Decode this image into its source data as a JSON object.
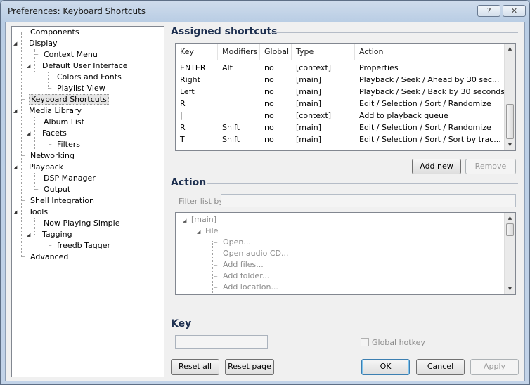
{
  "window": {
    "title": "Preferences: Keyboard Shortcuts",
    "help_label": "?",
    "close_label": "✕"
  },
  "tree": {
    "items": [
      {
        "label": "Components"
      },
      {
        "label": "Display"
      },
      {
        "label": "Context Menu"
      },
      {
        "label": "Default User Interface"
      },
      {
        "label": "Colors and Fonts"
      },
      {
        "label": "Playlist View"
      },
      {
        "label": "Keyboard Shortcuts"
      },
      {
        "label": "Media Library"
      },
      {
        "label": "Album List"
      },
      {
        "label": "Facets"
      },
      {
        "label": "Filters"
      },
      {
        "label": "Networking"
      },
      {
        "label": "Playback"
      },
      {
        "label": "DSP Manager"
      },
      {
        "label": "Output"
      },
      {
        "label": "Shell Integration"
      },
      {
        "label": "Tools"
      },
      {
        "label": "Now Playing Simple"
      },
      {
        "label": "Tagging"
      },
      {
        "label": "freedb Tagger"
      },
      {
        "label": "Advanced"
      }
    ]
  },
  "assigned": {
    "title": "Assigned shortcuts",
    "columns": [
      "Key",
      "Modifiers",
      "Global",
      "Type",
      "Action"
    ],
    "rows": [
      {
        "key": "ENTER",
        "modifiers": "Alt",
        "global": "no",
        "type": "[context]",
        "action": "Properties"
      },
      {
        "key": "Right",
        "modifiers": "",
        "global": "no",
        "type": "[main]",
        "action": "Playback / Seek / Ahead by 30 sec..."
      },
      {
        "key": "Left",
        "modifiers": "",
        "global": "no",
        "type": "[main]",
        "action": "Playback / Seek / Back by 30 seconds"
      },
      {
        "key": "R",
        "modifiers": "",
        "global": "no",
        "type": "[main]",
        "action": "Edit / Selection / Sort / Randomize"
      },
      {
        "key": "|",
        "modifiers": "",
        "global": "no",
        "type": "[context]",
        "action": "Add to playback queue"
      },
      {
        "key": "R",
        "modifiers": "Shift",
        "global": "no",
        "type": "[main]",
        "action": "Edit / Selection / Sort / Randomize"
      },
      {
        "key": "T",
        "modifiers": "Shift",
        "global": "no",
        "type": "[main]",
        "action": "Edit / Selection / Sort / Sort by trac..."
      }
    ],
    "add_new_label": "Add new",
    "remove_label": "Remove"
  },
  "action": {
    "title": "Action",
    "filter_label": "Filter list by:",
    "filter_value": "",
    "items": [
      {
        "label": "[main]"
      },
      {
        "label": "File"
      },
      {
        "label": "Open..."
      },
      {
        "label": "Open audio CD..."
      },
      {
        "label": "Add files..."
      },
      {
        "label": "Add folder..."
      },
      {
        "label": "Add location..."
      }
    ]
  },
  "key_section": {
    "title": "Key",
    "key_value": "",
    "global_hotkey_label": "Global hotkey"
  },
  "footer": {
    "reset_all_label": "Reset all",
    "reset_page_label": "Reset page",
    "ok_label": "OK",
    "cancel_label": "Cancel",
    "apply_label": "Apply"
  }
}
